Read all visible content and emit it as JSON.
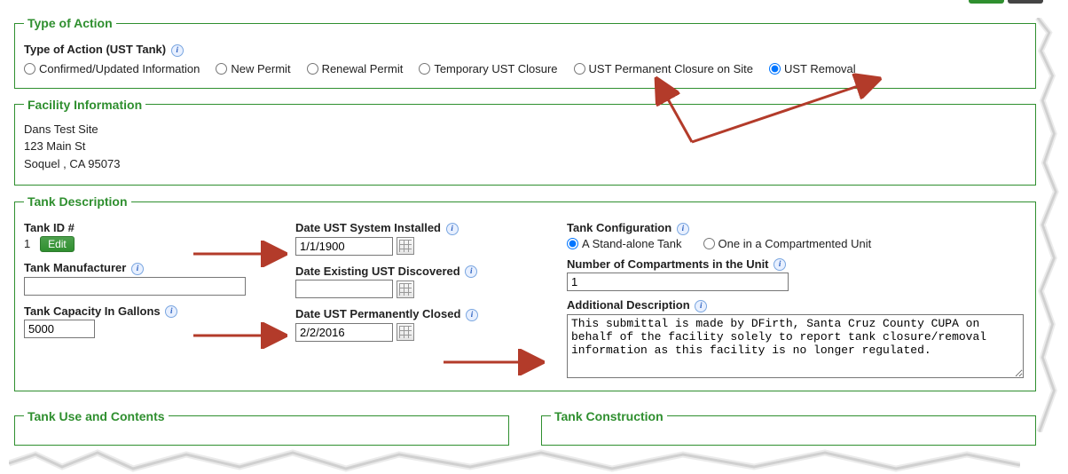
{
  "sections": {
    "type_of_action": {
      "legend": "Type of Action"
    },
    "facility_info": {
      "legend": "Facility Information"
    },
    "tank_desc": {
      "legend": "Tank Description"
    },
    "tank_use": {
      "legend": "Tank Use and Contents"
    },
    "tank_constr": {
      "legend": "Tank Construction"
    }
  },
  "type_of_action": {
    "label": "Type of Action (UST Tank)",
    "options": {
      "confirmed": "Confirmed/Updated Information",
      "new_permit": "New Permit",
      "renewal": "Renewal Permit",
      "temp_close": "Temporary UST Closure",
      "perm_close": "UST Permanent Closure on Site",
      "removal": "UST Removal"
    },
    "selected": "removal"
  },
  "facility": {
    "name": "Dans Test Site",
    "addr1": "123 Main St",
    "addr2": "Soquel  ,   CA   95073"
  },
  "tank": {
    "labels": {
      "tank_id": "Tank ID #",
      "edit_btn": "Edit",
      "manufacturer": "Tank Manufacturer",
      "capacity": "Tank Capacity In Gallons",
      "installed": "Date UST System Installed",
      "discovered": "Date Existing UST Discovered",
      "closed": "Date UST Permanently Closed",
      "config": "Tank Configuration",
      "comp_count": "Number of Compartments in the Unit",
      "add_desc": "Additional Description"
    },
    "tank_id": "1",
    "manufacturer": "",
    "capacity": "5000",
    "installed": "1/1/1900",
    "discovered": "",
    "closed": "2/2/2016",
    "config_options": {
      "standalone": "A Stand-alone Tank",
      "compartment": "One in a Compartmented Unit"
    },
    "config_selected": "standalone",
    "compartment_count": "1",
    "additional_desc": "This submittal is made by DFirth, Santa Cruz County CUPA on behalf of the facility solely to report tank closure/removal information as this facility is no longer regulated."
  }
}
